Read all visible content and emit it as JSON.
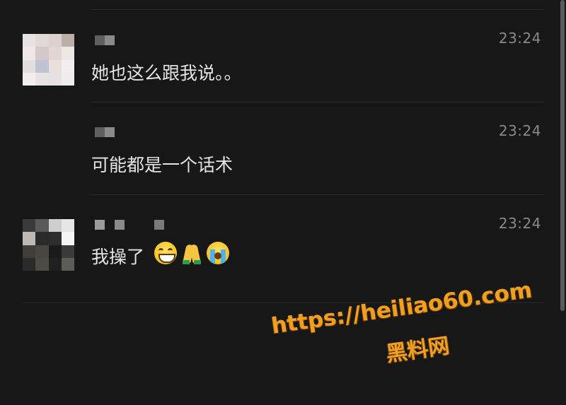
{
  "messages": [
    {
      "time": "23:24",
      "text": "她也这么跟我说。。"
    },
    {
      "time": "23:24",
      "text": "可能都是一个话术"
    },
    {
      "time": "23:24",
      "text": "我操了",
      "emojis": [
        "grinning-face",
        "folded-hands",
        "loudly-crying-face"
      ]
    }
  ],
  "watermark": {
    "url": "https://heiliao60.com",
    "name": "黑料网",
    "color": "#f0a020"
  },
  "colors": {
    "background": "#171717",
    "text": "#e4e4e4",
    "timestamp": "#8a8a8a",
    "divider": "#2c2c2c"
  }
}
